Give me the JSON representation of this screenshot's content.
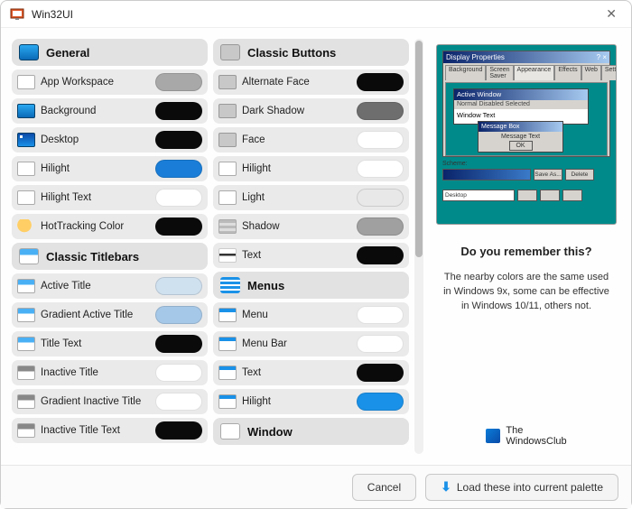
{
  "window": {
    "title": "Win32UI"
  },
  "footer": {
    "cancel": "Cancel",
    "load": "Load these into current palette"
  },
  "right": {
    "heading": "Do you remember this?",
    "desc": "The nearby colors are the same used in Windows 9x, some can be effective in Windows 10/11, others not.",
    "brand1": "The",
    "brand2": "WindowsClub",
    "preview": {
      "propTitle": "Display Properties",
      "tabs": [
        "Background",
        "Screen Saver",
        "Appearance",
        "Effects",
        "Web",
        "Settings"
      ],
      "activeTitle": "Active Window",
      "menu": "Normal    Disabled    Selected",
      "windowText": "Window Text",
      "msgTitle": "Message Box",
      "msgText": "Message Text",
      "ok": "OK",
      "schemeLabel": "Scheme:",
      "saveAs": "Save As...",
      "delete": "Delete",
      "item": "Desktop"
    }
  },
  "col1": {
    "s1": {
      "title": "General",
      "items": [
        {
          "label": "App Workspace",
          "sw": "#a8a8a8",
          "ic": "ic-white"
        },
        {
          "label": "Background",
          "sw": "#0a0a0a",
          "ic": "ic-monitor"
        },
        {
          "label": "Desktop",
          "sw": "#0a0a0a",
          "ic": "ic-desk"
        },
        {
          "label": "Hilight",
          "sw": "#1a7ed8",
          "ic": "ic-white"
        },
        {
          "label": "Hilight Text",
          "sw": "#ffffff",
          "ic": "ic-white"
        },
        {
          "label": "HotTracking Color",
          "sw": "#0a0a0a",
          "ic": "ic-hand"
        }
      ]
    },
    "s2": {
      "title": "Classic Titlebars",
      "items": [
        {
          "label": "Active Title",
          "sw": "#cfe0ef",
          "ic": "ic-titlebar"
        },
        {
          "label": "Gradient Active Title",
          "sw": "#a6c8e8",
          "ic": "ic-titlebar"
        },
        {
          "label": "Title Text",
          "sw": "#0a0a0a",
          "ic": "ic-titlebar"
        },
        {
          "label": "Inactive Title",
          "sw": "#ffffff",
          "ic": "ic-titlebar-g"
        },
        {
          "label": "Gradient Inactive Title",
          "sw": "#ffffff",
          "ic": "ic-titlebar-g"
        },
        {
          "label": "Inactive Title Text",
          "sw": "#0a0a0a",
          "ic": "ic-titlebar-g"
        }
      ]
    }
  },
  "col2": {
    "s1": {
      "title": "Classic Buttons",
      "items": [
        {
          "label": "Alternate Face",
          "sw": "#0a0a0a",
          "ic": "ic-gray"
        },
        {
          "label": "Dark Shadow",
          "sw": "#6e6e6e",
          "ic": "ic-gray"
        },
        {
          "label": "Face",
          "sw": "#ffffff",
          "ic": "ic-gray"
        },
        {
          "label": "Hilight",
          "sw": "#ffffff",
          "ic": "ic-white"
        },
        {
          "label": "Light",
          "sw": "#e8e8e8",
          "ic": "ic-white"
        },
        {
          "label": "Shadow",
          "sw": "#a0a0a0",
          "ic": "ic-shadow"
        },
        {
          "label": "Text",
          "sw": "#0a0a0a",
          "ic": "ic-line"
        }
      ]
    },
    "s2": {
      "title": "Menus",
      "items": [
        {
          "label": "Menu",
          "sw": "#ffffff",
          "ic": "ic-menu"
        },
        {
          "label": "Menu Bar",
          "sw": "#ffffff",
          "ic": "ic-menu"
        },
        {
          "label": "Text",
          "sw": "#0a0a0a",
          "ic": "ic-menu"
        },
        {
          "label": "Hilight",
          "sw": "#1a91e8",
          "ic": "ic-menu"
        }
      ]
    },
    "s3": {
      "title": "Window"
    }
  }
}
